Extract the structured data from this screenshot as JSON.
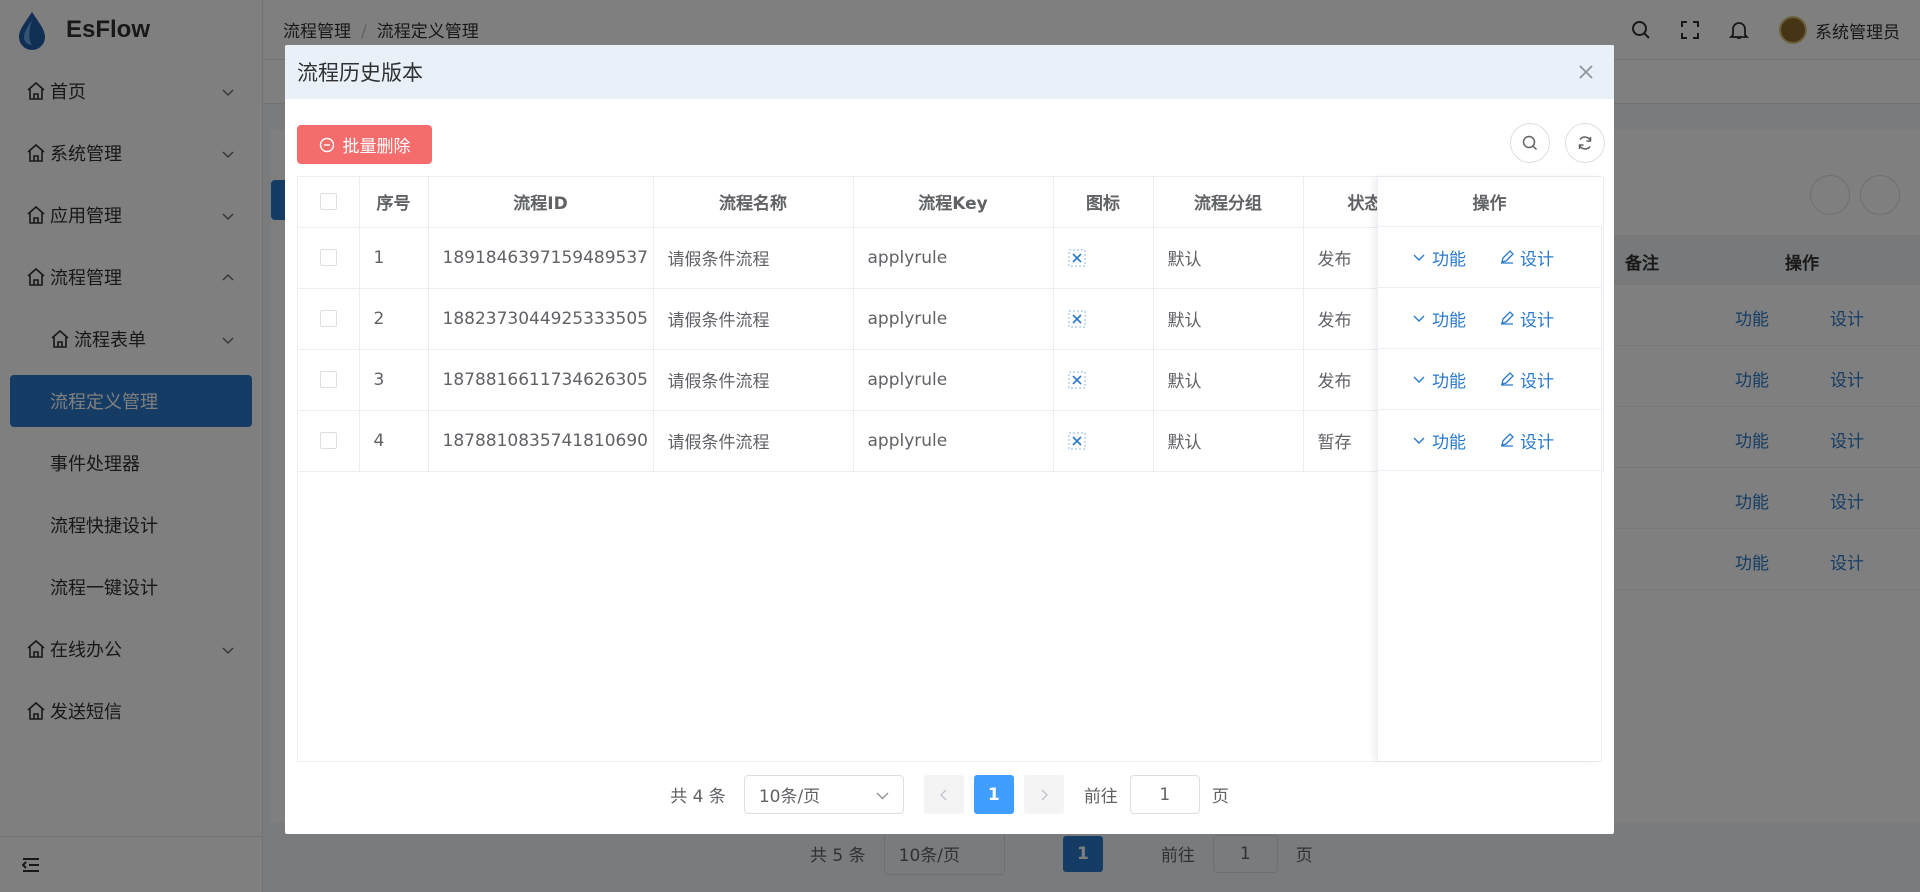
{
  "app": {
    "name": "EsFlow"
  },
  "sidebar": {
    "items": [
      {
        "label": "首页",
        "level": 1,
        "expanded": false
      },
      {
        "label": "系统管理",
        "level": 1,
        "expanded": false
      },
      {
        "label": "应用管理",
        "level": 1,
        "expanded": false
      },
      {
        "label": "流程管理",
        "level": 1,
        "expanded": true
      },
      {
        "label": "流程表单",
        "level": 2,
        "expanded": false
      },
      {
        "label": "流程定义管理",
        "level": 2,
        "active": true
      },
      {
        "label": "事件处理器",
        "level": 2
      },
      {
        "label": "流程快捷设计",
        "level": 2
      },
      {
        "label": "流程一键设计",
        "level": 2
      },
      {
        "label": "在线办公",
        "level": 1,
        "expanded": false
      },
      {
        "label": "发送短信",
        "level": 1
      }
    ]
  },
  "header": {
    "breadcrumb": [
      "流程管理",
      "流程定义管理"
    ],
    "breadcrumb_sep": "/",
    "user": "系统管理员"
  },
  "background": {
    "table_headers": [
      "备注",
      "操作"
    ],
    "row_links": [
      "功能",
      "设计"
    ],
    "pager": {
      "total": "共 5 条",
      "page_size": "10条/页",
      "current": "1",
      "goto": "前往",
      "goto_value": "1",
      "page_unit": "页"
    }
  },
  "dialog": {
    "title": "流程历史版本",
    "batch_delete": "批量删除",
    "columns": [
      "序号",
      "流程ID",
      "流程名称",
      "流程Key",
      "图标",
      "流程分组",
      "状态",
      "操作"
    ],
    "rows": [
      {
        "index": "1",
        "id": "1891846397159489537",
        "name": "请假条件流程",
        "key": "applyrule",
        "group": "默认",
        "status": "发布",
        "ops": [
          "功能",
          "设计"
        ]
      },
      {
        "index": "2",
        "id": "1882373044925333505",
        "name": "请假条件流程",
        "key": "applyrule",
        "group": "默认",
        "status": "发布",
        "ops": [
          "功能",
          "设计"
        ]
      },
      {
        "index": "3",
        "id": "1878816611734626305",
        "name": "请假条件流程",
        "key": "applyrule",
        "group": "默认",
        "status": "发布",
        "ops": [
          "功能",
          "设计"
        ]
      },
      {
        "index": "4",
        "id": "1878810835741810690",
        "name": "请假条件流程",
        "key": "applyrule",
        "group": "默认",
        "status": "暂存",
        "ops": [
          "功能",
          "设计"
        ]
      }
    ],
    "pager": {
      "total": "共 4 条",
      "page_size": "10条/页",
      "current": "1",
      "goto": "前往",
      "goto_value": "1",
      "page_unit": "页"
    }
  },
  "colors": {
    "primary": "#2a79c9",
    "danger": "#f56c6c",
    "page_active": "#409eff"
  }
}
